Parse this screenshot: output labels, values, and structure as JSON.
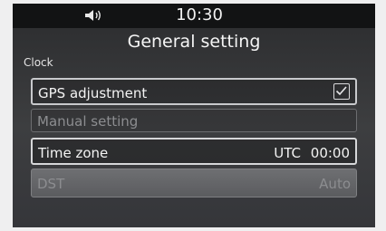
{
  "status_bar": {
    "time": "10:30",
    "volume_icon": "speaker-icon"
  },
  "header": {
    "title": "General setting"
  },
  "section": {
    "label": "Clock"
  },
  "rows": [
    {
      "label": "GPS adjustment",
      "checked": true
    },
    {
      "label": "Manual setting",
      "enabled": false
    },
    {
      "label": "Time zone",
      "value": "UTC 00:00"
    },
    {
      "label": "DST",
      "value": "Auto",
      "enabled": false
    }
  ],
  "colors": {
    "background": "#35363a",
    "status_bar": "#121314",
    "text": "#f3f3f3",
    "disabled_text": "#8c8d90"
  }
}
